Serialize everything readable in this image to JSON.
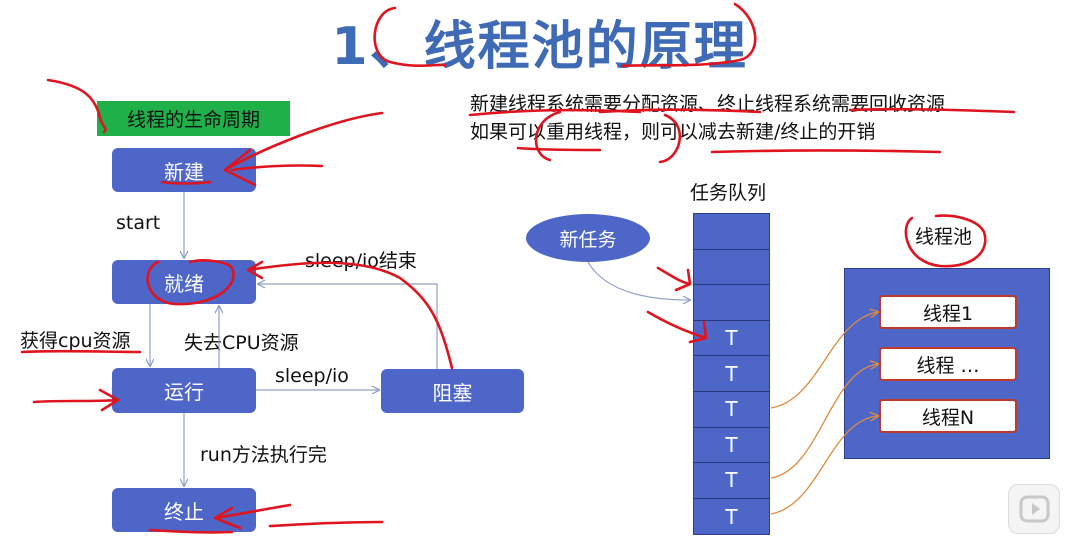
{
  "title": "1、线程池的原理",
  "legend": "线程的生命周期",
  "states": {
    "new": "新建",
    "ready": "就绪",
    "running": "运行",
    "blocked": "阻塞",
    "terminated": "终止"
  },
  "transitions": {
    "start": "start",
    "sleep_end": "sleep/io结束",
    "get_cpu": "获得cpu资源",
    "lose_cpu": "失去CPU资源",
    "sleep_io": "sleep/io",
    "run_done": "run方法执行完"
  },
  "notes": {
    "line1": "新建线程系统需要分配资源、终止线程系统需要回收资源",
    "line2": "如果可以重用线程，则可以减去新建/终止的开销"
  },
  "queue": {
    "title": "任务队列",
    "new_task": "新任务",
    "cells": [
      "",
      "",
      "",
      "T",
      "T",
      "T",
      "T",
      "T",
      "T"
    ]
  },
  "pool": {
    "title": "线程池",
    "threads": [
      "线程1",
      "线程 …",
      "线程N"
    ]
  },
  "colors": {
    "state_fill": "#4d66c8",
    "title": "#3f6ab5",
    "legend_fill": "#1fb04a",
    "annotation": "#e0141e",
    "connector": "#e08a3c"
  },
  "icons": {
    "player": "play-icon"
  }
}
